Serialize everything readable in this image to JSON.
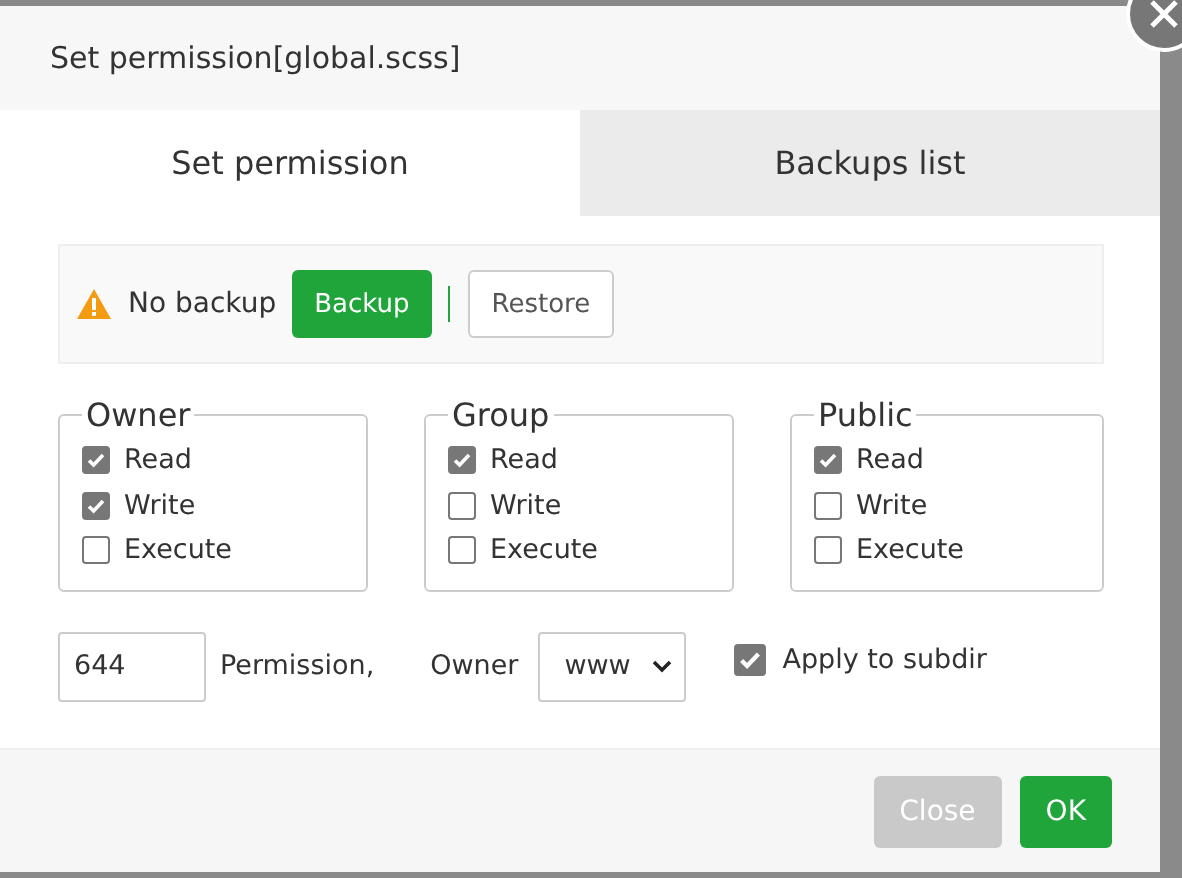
{
  "dialog": {
    "title": "Set permission[global.scss]"
  },
  "tabs": [
    {
      "label": "Set permission",
      "selected": true
    },
    {
      "label": "Backups list",
      "selected": false
    }
  ],
  "backup_bar": {
    "status": "No backup",
    "backup_button": "Backup",
    "restore_button": "Restore"
  },
  "groups": [
    {
      "legend": "Owner",
      "options": [
        {
          "label": "Read",
          "checked": true
        },
        {
          "label": "Write",
          "checked": true
        },
        {
          "label": "Execute",
          "checked": false
        }
      ]
    },
    {
      "legend": "Group",
      "options": [
        {
          "label": "Read",
          "checked": true
        },
        {
          "label": "Write",
          "checked": false
        },
        {
          "label": "Execute",
          "checked": false
        }
      ]
    },
    {
      "legend": "Public",
      "options": [
        {
          "label": "Read",
          "checked": true
        },
        {
          "label": "Write",
          "checked": false
        },
        {
          "label": "Execute",
          "checked": false
        }
      ]
    }
  ],
  "permission": {
    "value": "644",
    "label": "Permission,"
  },
  "owner": {
    "label": "Owner",
    "value": "www"
  },
  "apply_to_subdir": {
    "label": "Apply to subdir",
    "checked": true
  },
  "buttons": [
    {
      "label": "Close",
      "kind": "secondary"
    },
    {
      "label": "OK",
      "kind": "primary"
    }
  ]
}
